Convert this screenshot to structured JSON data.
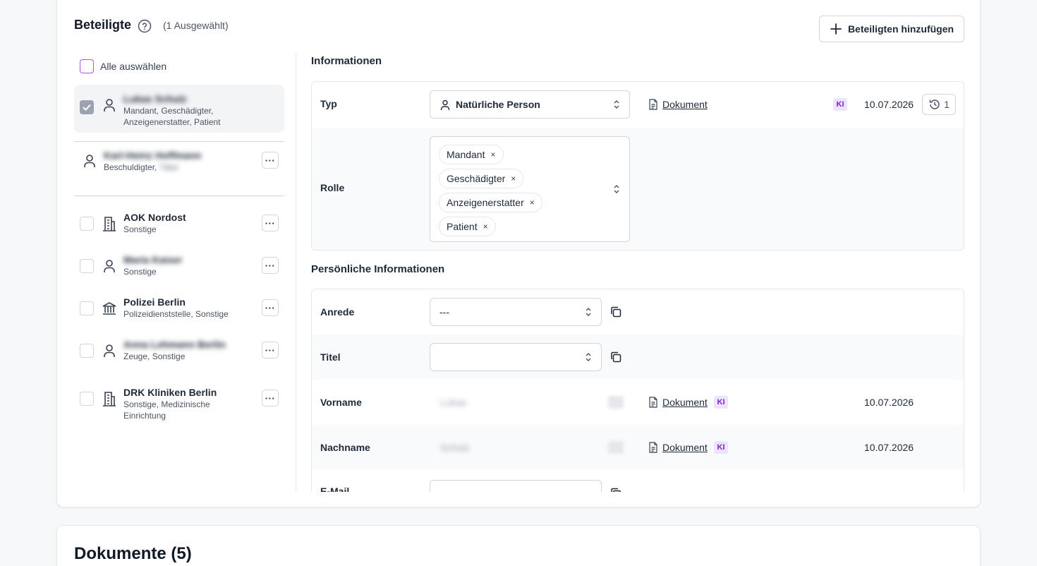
{
  "header": {
    "title": "Beteiligte",
    "selected_count": "(1 Ausgewählt)",
    "add_button": "Beteiligten hinzufügen"
  },
  "left": {
    "select_all": "Alle auswählen",
    "parties": [
      {
        "name": "Lukas Schulz",
        "roles_line1": "Mandant, Geschädigter,",
        "roles_line2": "Anzeigenerstatter, Patient",
        "icon": "person-icon",
        "name_blurred": true,
        "selected": true
      },
      {
        "name": "Karl-Heinz Hoffmann",
        "roles_line1": "Beschuldigter,",
        "roles_blurred_tail": "Täter",
        "icon": "person-icon",
        "name_blurred": true
      },
      {
        "name": "AOK Nordost",
        "roles_line1": "Sonstige",
        "icon": "building-icon"
      },
      {
        "name": "Maria Kaiser",
        "roles_line1": "Sonstige",
        "icon": "person-icon",
        "name_blurred": true
      },
      {
        "name": "Polizei Berlin",
        "roles_line1": "Polizeidienststelle, Sonstige",
        "icon": "institution-icon"
      },
      {
        "name": "Anna Lehmann Berlin",
        "roles_line1": "Zeuge, Sonstige",
        "icon": "person-icon",
        "name_blurred": true
      },
      {
        "name": "DRK Kliniken Berlin",
        "roles_line1": "Sonstige, Medizinische",
        "roles_line2": "Einrichtung",
        "icon": "building-icon"
      }
    ]
  },
  "info": {
    "title": "Informationen",
    "typ": {
      "label": "Typ",
      "value": "Natürliche Person",
      "doc": "Dokument",
      "ki": "KI",
      "date": "10.07.2026",
      "history_count": "1"
    },
    "rolle": {
      "label": "Rolle",
      "chips": [
        "Mandant",
        "Geschädigter",
        "Anzeigenerstatter",
        "Patient"
      ],
      "remove_glyph": "×"
    }
  },
  "personal": {
    "title": "Persönliche Informationen",
    "anrede": {
      "label": "Anrede",
      "value": "---"
    },
    "titel": {
      "label": "Titel",
      "value": ""
    },
    "vorname": {
      "label": "Vorname",
      "value": "Lukas",
      "doc": "Dokument",
      "ki": "KI",
      "date": "10.07.2026"
    },
    "nachname": {
      "label": "Nachname",
      "value": "Schulz",
      "doc": "Dokument",
      "ki": "KI",
      "date": "10.07.2026"
    },
    "email": {
      "label": "E-Mail"
    }
  },
  "documents": {
    "title": "Dokumente (5)"
  },
  "colors": {
    "accent_purple": "#a855f7",
    "ki_bg": "#ede3fb",
    "ki_text": "#7e22ce"
  }
}
